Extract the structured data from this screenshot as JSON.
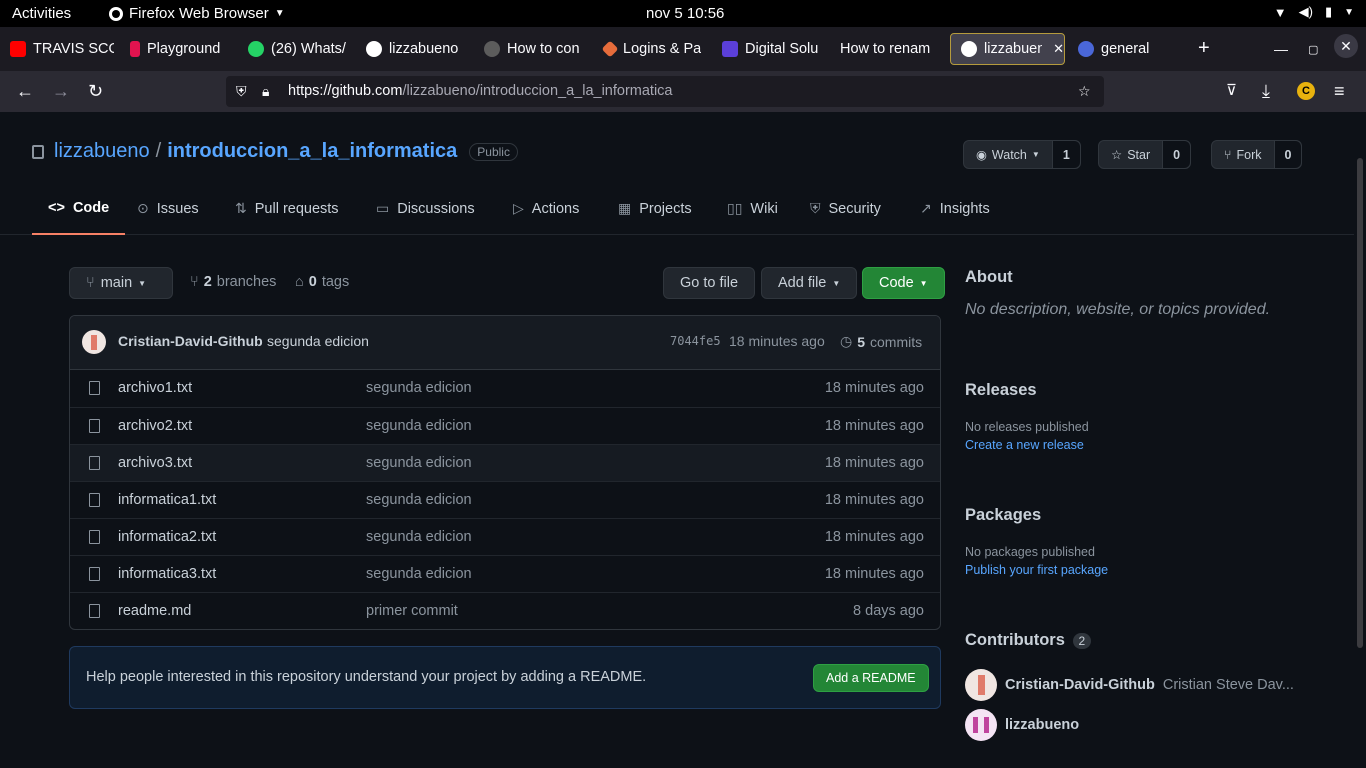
{
  "system": {
    "activities": "Activities",
    "app_name": "Firefox Web Browser",
    "clock": "nov 5  10:56"
  },
  "browser": {
    "tabs": [
      {
        "label": "TRAVIS SCO",
        "color": "#ff0000"
      },
      {
        "label": "Playground",
        "color": "#e2134f"
      },
      {
        "label": "(26) Whats/",
        "color": "#25d366"
      },
      {
        "label": "lizzabueno",
        "color": "#ffffff"
      },
      {
        "label": "How to con",
        "color": "#8b8b8b"
      },
      {
        "label": "Logins & Pa",
        "color": "#e66c3b"
      },
      {
        "label": "Digital Solu",
        "color": "#5b3fd9"
      },
      {
        "label": "How to renam",
        "color": "#2b2a33"
      },
      {
        "label": "lizzabueno",
        "color": "#ffffff"
      },
      {
        "label": "general",
        "color": "#4a67d8"
      }
    ],
    "new_tab": "+",
    "url_host": "https://github.com",
    "url_path": "/lizzabueno/introduccion_a_la_informatica",
    "profile_initial": "C"
  },
  "repo": {
    "owner": "lizzabueno",
    "separator": "/",
    "name": "introduccion_a_la_informatica",
    "visibility": "Public",
    "watch_label": "Watch",
    "watch_count": "1",
    "star_label": "Star",
    "star_count": "0",
    "fork_label": "Fork",
    "fork_count": "0"
  },
  "nav": {
    "tabs": [
      "Code",
      "Issues",
      "Pull requests",
      "Discussions",
      "Actions",
      "Projects",
      "Wiki",
      "Security",
      "Insights"
    ]
  },
  "toolbar": {
    "branch": "main",
    "branches_count": "2",
    "branches_label": "branches",
    "tags_count": "0",
    "tags_label": "tags",
    "goto_file": "Go to file",
    "add_file": "Add file",
    "code": "Code"
  },
  "latest_commit": {
    "author": "Cristian-David-Github",
    "message": "segunda edicion",
    "sha": "7044fe5",
    "time": "18 minutes ago",
    "commits_count": "5",
    "commits_label": "commits"
  },
  "files": [
    {
      "name": "archivo1.txt",
      "message": "segunda edicion",
      "time": "18 minutes ago"
    },
    {
      "name": "archivo2.txt",
      "message": "segunda edicion",
      "time": "18 minutes ago"
    },
    {
      "name": "archivo3.txt",
      "message": "segunda edicion",
      "time": "18 minutes ago"
    },
    {
      "name": "informatica1.txt",
      "message": "segunda edicion",
      "time": "18 minutes ago"
    },
    {
      "name": "informatica2.txt",
      "message": "segunda edicion",
      "time": "18 minutes ago"
    },
    {
      "name": "informatica3.txt",
      "message": "segunda edicion",
      "time": "18 minutes ago"
    },
    {
      "name": "readme.md",
      "message": "primer commit",
      "time": "8 days ago"
    }
  ],
  "readme_prompt": {
    "text": "Help people interested in this repository understand your project by adding a README.",
    "button": "Add a README"
  },
  "sidebar": {
    "about_title": "About",
    "about_desc": "No description, website, or topics provided.",
    "releases_title": "Releases",
    "releases_none": "No releases published",
    "releases_link": "Create a new release",
    "packages_title": "Packages",
    "packages_none": "No packages published",
    "packages_link": "Publish your first package",
    "contributors_title": "Contributors",
    "contributors_count": "2",
    "contributors": [
      {
        "login": "Cristian-David-Github",
        "name": "Cristian Steve Dav..."
      },
      {
        "login": "lizzabueno",
        "name": ""
      }
    ]
  }
}
